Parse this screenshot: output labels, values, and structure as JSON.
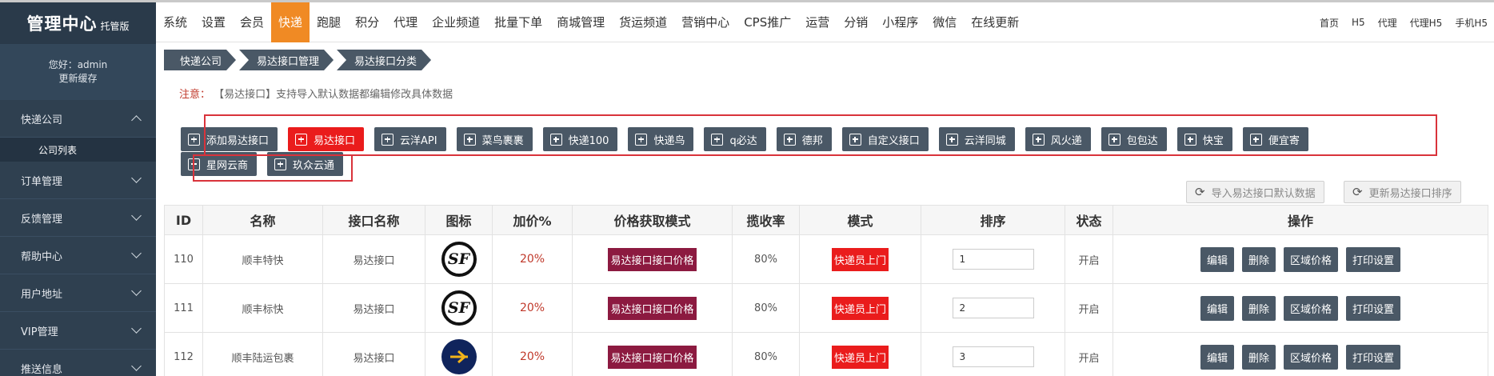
{
  "sidebar": {
    "title": "管理中心",
    "title_badge": "托管版",
    "greeting": "您好：admin",
    "refresh_cache": "更新缓存",
    "items": [
      {
        "label": "快递公司"
      },
      {
        "label": "订单管理"
      },
      {
        "label": "反馈管理"
      },
      {
        "label": "帮助中心"
      },
      {
        "label": "用户地址"
      },
      {
        "label": "VIP管理"
      },
      {
        "label": "推送信息"
      }
    ],
    "sub_item": "公司列表"
  },
  "topnav": {
    "items": [
      "系统",
      "设置",
      "会员",
      "快递",
      "跑腿",
      "积分",
      "代理",
      "企业频道",
      "批量下单",
      "商城管理",
      "货运频道",
      "营销中心",
      "CPS推广",
      "运营",
      "分销",
      "小程序",
      "微信",
      "在线更新"
    ],
    "active": "快递",
    "right": [
      "首页",
      "H5",
      "代理",
      "代理H5",
      "手机H5"
    ]
  },
  "breadcrumb": [
    "快递公司",
    "易达接口管理",
    "易达接口分类"
  ],
  "notice": {
    "label": "注意：",
    "text": "【易达接口】支持导入默认数据都编辑修改具体数据"
  },
  "channel_buttons": {
    "row1": [
      "添加易达接口",
      "易达接口",
      "云洋API",
      "菜鸟裹裹",
      "快递100",
      "快递鸟",
      "q必达",
      "德邦",
      "自定义接口",
      "云洋同城",
      "风火递",
      "包包达",
      "快宝",
      "便宜寄"
    ],
    "row2": [
      "星网云商",
      "玖众云通"
    ],
    "active": "易达接口"
  },
  "actions": {
    "import_default": "导入易达接口默认数据",
    "update_sort": "更新易达接口排序"
  },
  "table": {
    "headers": [
      "ID",
      "名称",
      "接口名称",
      "图标",
      "加价%",
      "价格获取模式",
      "揽收率",
      "模式",
      "排序",
      "状态",
      "操作"
    ],
    "rows": [
      {
        "id": "110",
        "name": "顺丰特快",
        "api": "易达接口",
        "icon": "sf-express-logo",
        "markup": "20%",
        "price_mode": "易达接口接口价格",
        "rate": "80%",
        "mode": "快递员上门",
        "sort": "1",
        "status": "开启"
      },
      {
        "id": "111",
        "name": "顺丰标快",
        "api": "易达接口",
        "icon": "sf-express-logo",
        "markup": "20%",
        "price_mode": "易达接口接口价格",
        "rate": "80%",
        "mode": "快递员上门",
        "sort": "2",
        "status": "开启"
      },
      {
        "id": "112",
        "name": "顺丰陆运包裹",
        "api": "易达接口",
        "icon": "sf-freight-logo",
        "markup": "20%",
        "price_mode": "易达接口接口价格",
        "rate": "80%",
        "mode": "快递员上门",
        "sort": "3",
        "status": "开启"
      }
    ],
    "row_ops": [
      "编辑",
      "删除",
      "区域价格",
      "打印设置"
    ]
  },
  "colors": {
    "sidebar_bg": "#2f4050",
    "nav_active": "#f08a24",
    "button_dark": "#4a5866",
    "button_red": "#ea1c1c",
    "price_mode_tag": "#8c1a40",
    "highlight_box": "#d9333b"
  }
}
